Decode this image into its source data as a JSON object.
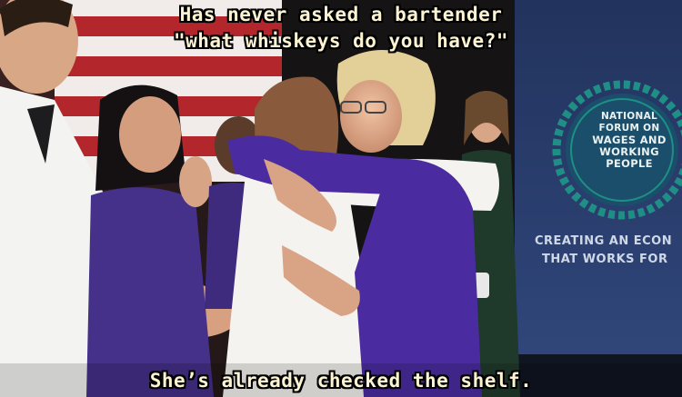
{
  "meme": {
    "top_caption_line1": "Has never asked a bartender",
    "top_caption_line2": "\"what whiskeys do you have?\"",
    "bottom_caption": "She’s already checked the shelf."
  },
  "banner": {
    "seal_line1": "NATIONAL",
    "seal_line2": "FORUM ON",
    "seal_line3": "WAGES AND",
    "seal_line4": "WORKING",
    "seal_line5": "PEOPLE",
    "slogan_line1": "CREATING AN ECON",
    "slogan_line2": "THAT WORKS FOR"
  },
  "colors": {
    "banner_blue": "#2b3e6b",
    "seal_teal": "#1f8f86",
    "shirt_purple": "#4b2ca0",
    "caption_text": "#fbf3d2"
  }
}
